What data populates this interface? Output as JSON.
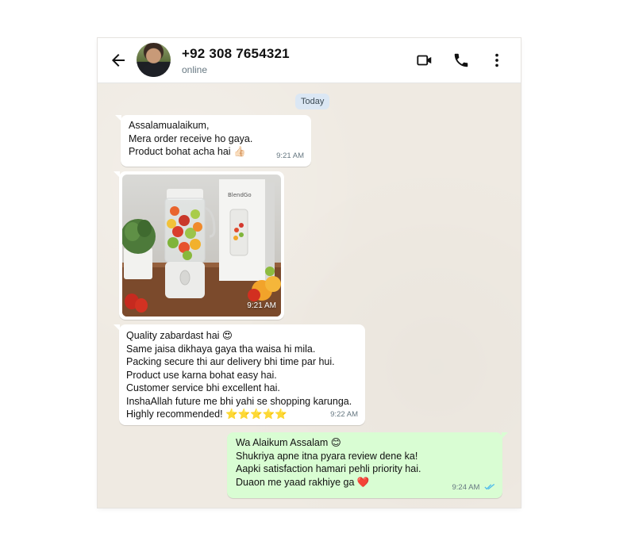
{
  "header": {
    "contact_name": "+92 308 7654321",
    "status": "online"
  },
  "day_chip": "Today",
  "messages": [
    {
      "direction": "incoming",
      "lines": [
        "Assalamualaikum,",
        "Mera order receive ho gaya.",
        "Product bohat acha hai 👍🏻"
      ],
      "time": "9:21 AM"
    },
    {
      "direction": "incoming",
      "type": "image",
      "image_text": "BlendGo",
      "time": "9:21 AM"
    },
    {
      "direction": "incoming",
      "lines": [
        "Quality zabardast hai 😍",
        "Same jaisa dikhaya gaya tha waisa hi mila.",
        "Packing secure thi aur delivery bhi time par hui.",
        "Product use karna bohat easy hai.",
        "Customer service bhi excellent hai.",
        "InshaAllah future me bhi yahi se shopping karunga.",
        "Highly recommended! ⭐⭐⭐⭐⭐"
      ],
      "time": "9:22 AM"
    },
    {
      "direction": "outgoing",
      "lines": [
        "Wa Alaikum Assalam 😊",
        "Shukriya apne itna pyara review dene ka!",
        "Aapki satisfaction hamari pehli priority hai.",
        "Duaon me yaad rakhiye ga ❤️"
      ],
      "time": "9:24 AM",
      "read_status": "read"
    }
  ],
  "colors": {
    "chat_background": "#efeae2",
    "outgoing_bubble": "#d9fdd3",
    "incoming_bubble": "#ffffff",
    "read_ticks": "#53bdeb",
    "day_chip": "#dbe7f4"
  },
  "icons": [
    "back-arrow-icon",
    "video-call-icon",
    "phone-icon",
    "more-vertical-icon",
    "double-check-icon"
  ]
}
